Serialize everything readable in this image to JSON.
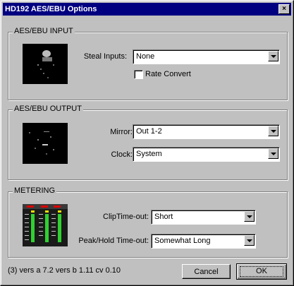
{
  "window": {
    "title": "HD192 AES/EBU Options",
    "close_glyph": "×"
  },
  "input_group": {
    "legend": "AES/EBU INPUT",
    "steal_label": "Steal Inputs:",
    "steal_value": "None",
    "rate_convert_label": "Rate Convert",
    "rate_convert_checked": false
  },
  "output_group": {
    "legend": "AES/EBU OUTPUT",
    "mirror_label": "Mirror:",
    "mirror_value": "Out 1-2",
    "clock_label": "Clock:",
    "clock_value": "System"
  },
  "metering_group": {
    "legend": "METERING",
    "clip_label": "ClipTime-out:",
    "clip_value": "Short",
    "peak_label": "Peak/Hold Time-out:",
    "peak_value": "Somewhat Long"
  },
  "footer": {
    "version": "(3) vers a 7.2 vers b 1.11 cv 0.10",
    "cancel_label": "Cancel",
    "ok_label": "OK"
  }
}
